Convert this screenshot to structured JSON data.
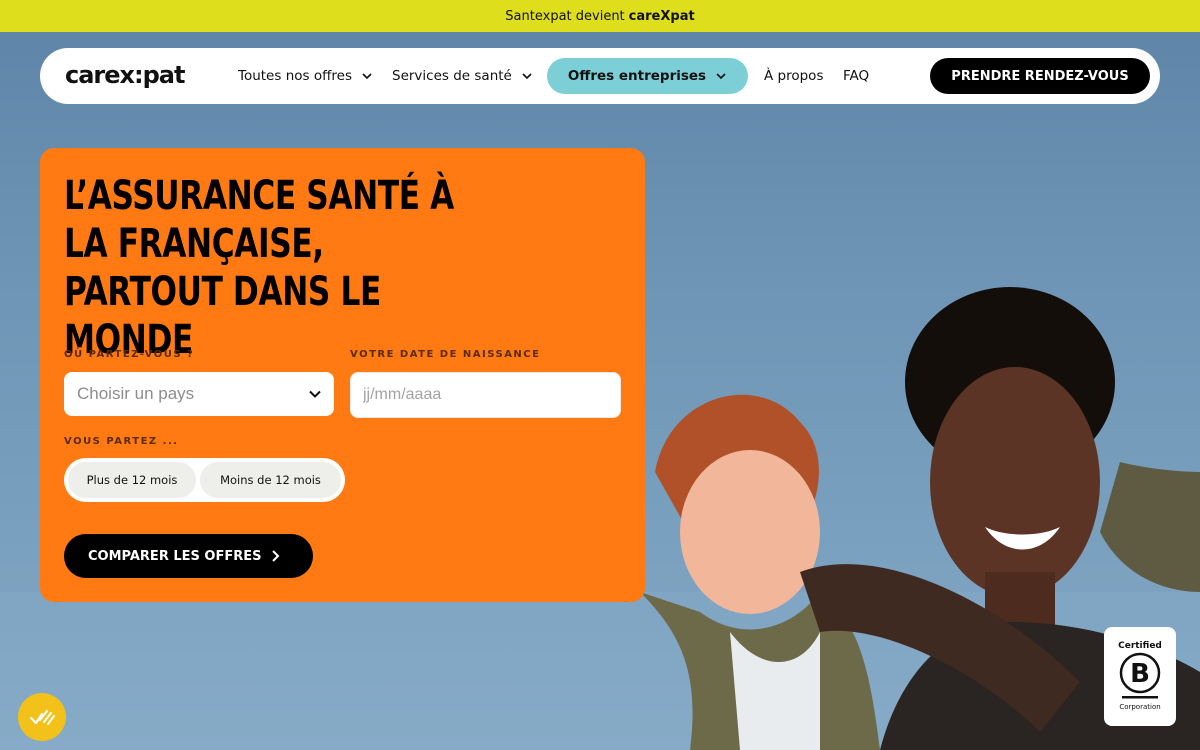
{
  "announcement": {
    "prefix": "Santexpat devient",
    "brand": "careXpat"
  },
  "nav": {
    "logo": "carex:pat",
    "items": [
      {
        "label": "Toutes nos offres"
      },
      {
        "label": "Services de santé"
      }
    ],
    "highlight": {
      "label": "Offres entreprises"
    },
    "links": [
      {
        "label": "À propos"
      },
      {
        "label": "FAQ"
      }
    ],
    "cta": "PRENDRE RENDEZ-VOUS"
  },
  "hero": {
    "title": "L’assurance santé à la française, partout dans le monde",
    "country_label": "OÙ PARTEZ-VOUS ?",
    "country_placeholder": "Choisir un pays",
    "birth_label": "VOTRE DATE DE NAISSANCE",
    "birth_placeholder": "jj/mm/aaaa",
    "duration_label": "VOUS PARTEZ ...",
    "duration_options": [
      "Plus de 12 mois",
      "Moins de 12 mois"
    ],
    "compare_button": "COMPARER LES OFFRES"
  },
  "badge": {
    "certified": "Certified",
    "corporation": "Corporation"
  },
  "colors": {
    "announce_bg": "#dede1c",
    "card_bg": "#ff7a12",
    "pill_bg": "#7ccfd6",
    "fab_bg": "#f2c21a",
    "cta_bg": "#000000"
  },
  "icons": {
    "nav_chevron": "chevron-down-icon",
    "select_chevron": "chevron-down-icon",
    "compare_arrow": "chevron-right-icon",
    "b_corp": "b-corp-logo-icon",
    "accessibility": "accessibility-icon"
  }
}
